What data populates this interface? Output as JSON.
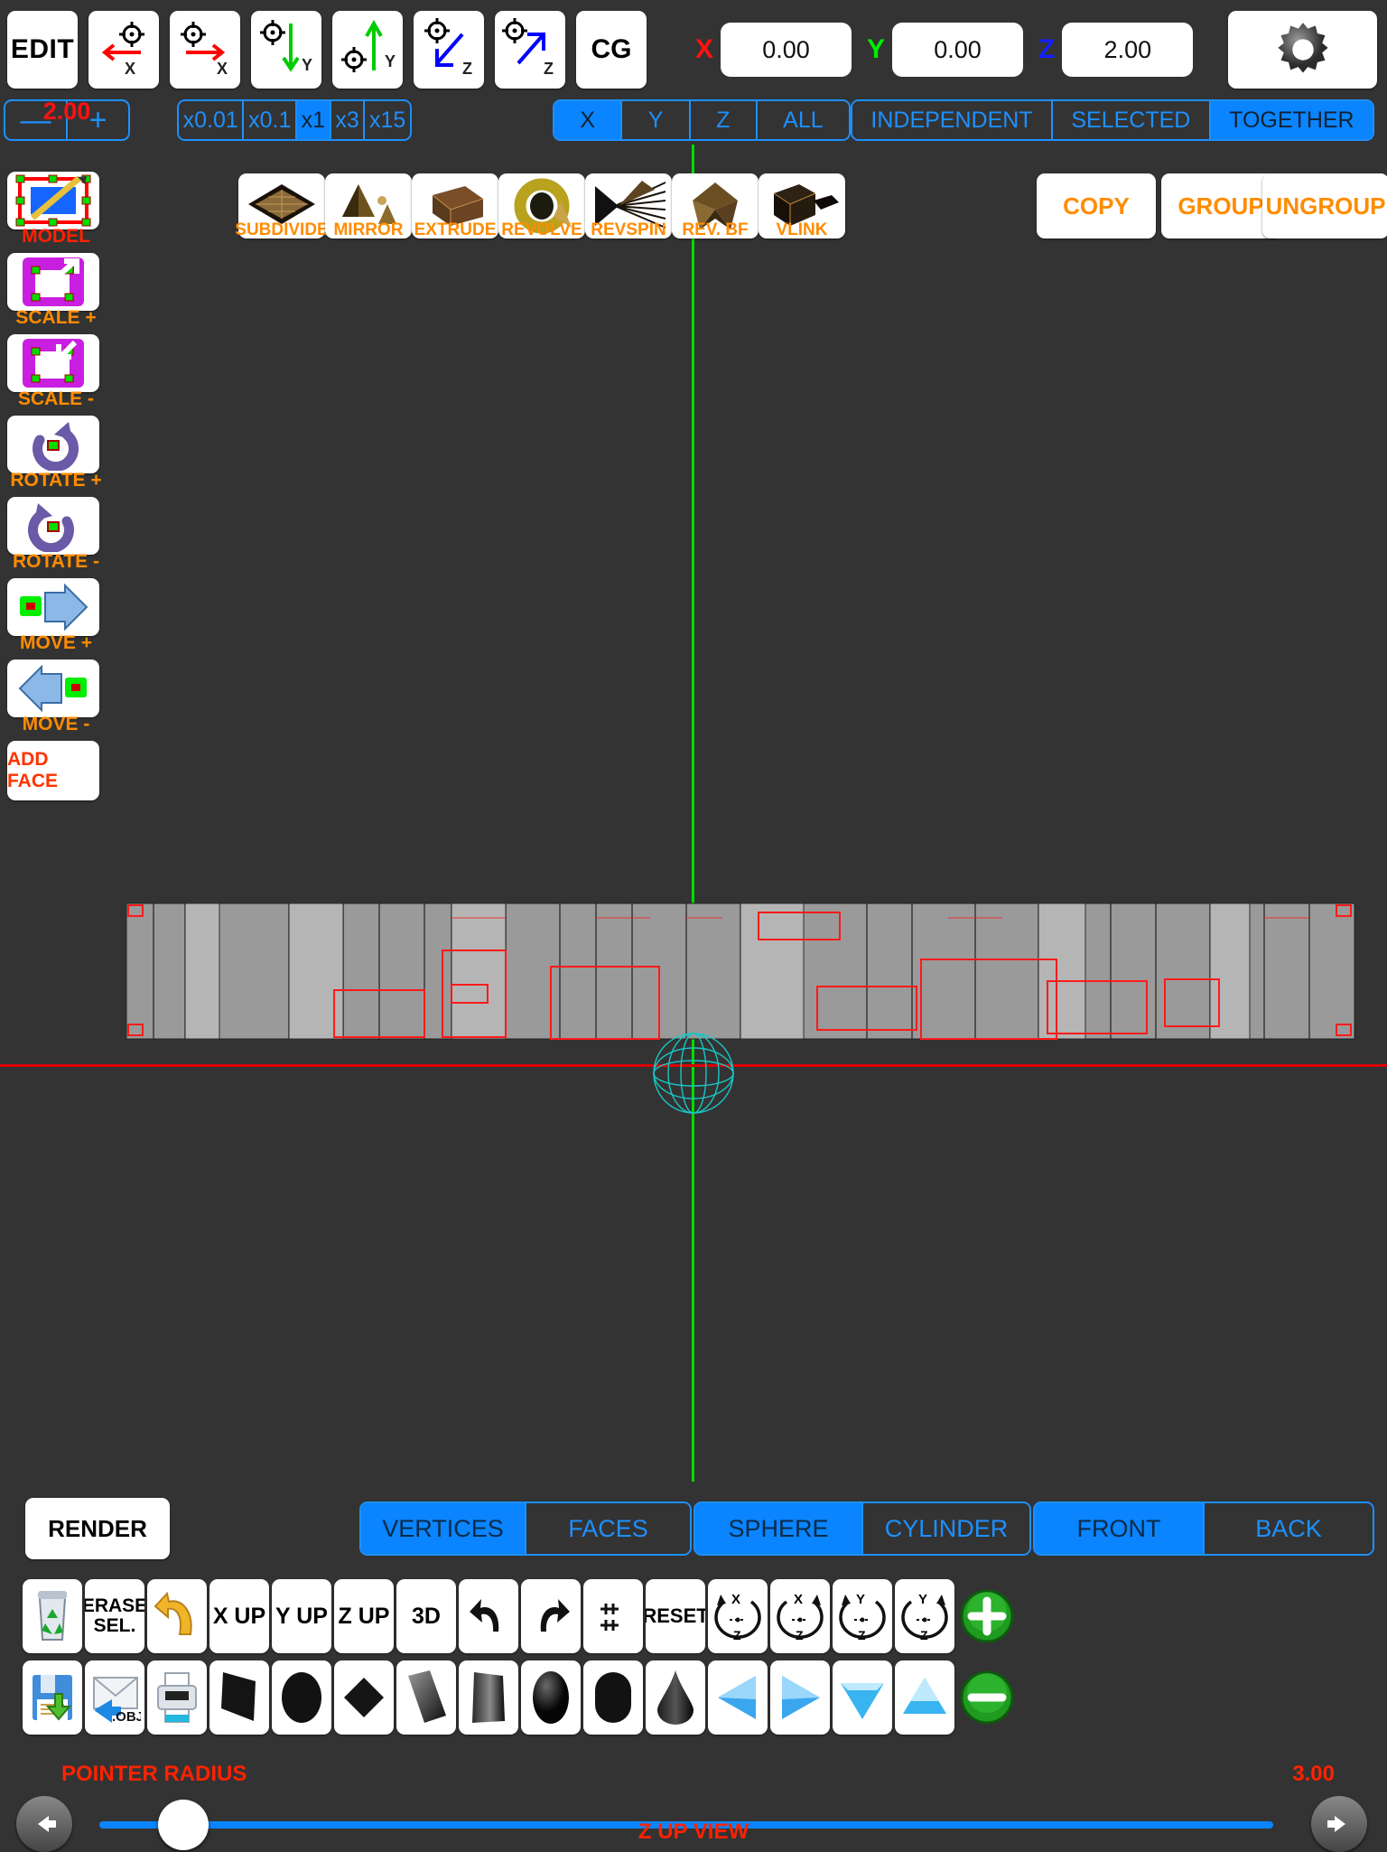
{
  "top_toolbar": {
    "edit_label": "EDIT",
    "cg_label": "CG",
    "axis_buttons": [
      {
        "name": "move-neg-x",
        "axis": "X",
        "color": "#ff0000",
        "dir": "left"
      },
      {
        "name": "move-pos-x",
        "axis": "X",
        "color": "#ff0000",
        "dir": "right"
      },
      {
        "name": "move-neg-y",
        "axis": "Y",
        "color": "#00cc00",
        "dir": "down"
      },
      {
        "name": "move-pos-y",
        "axis": "Y",
        "color": "#00cc00",
        "dir": "up"
      },
      {
        "name": "move-neg-z",
        "axis": "Z",
        "color": "#0000ff",
        "dir": "downleft"
      },
      {
        "name": "move-pos-z",
        "axis": "Z",
        "color": "#0000ff",
        "dir": "upright"
      }
    ],
    "coords": [
      {
        "axis": "X",
        "color": "#ff0000",
        "value": "0.00"
      },
      {
        "axis": "Y",
        "color": "#00ee00",
        "value": "0.00"
      },
      {
        "axis": "Z",
        "color": "#1122ff",
        "value": "2.00"
      }
    ],
    "settings_icon": "gear-icon"
  },
  "step_row": {
    "stepper_value": "2.00",
    "minus_label": "—",
    "plus_label": "+",
    "multipliers": {
      "options": [
        "x0.01",
        "x0.1",
        "x1",
        "x3",
        "x15"
      ],
      "selected": "x1"
    },
    "axes": {
      "options": [
        "X",
        "Y",
        "Z",
        "ALL"
      ],
      "selected": "X"
    },
    "mode": {
      "options": [
        "INDEPENDENT",
        "SELECTED",
        "TOGETHER"
      ],
      "selected": "TOGETHER"
    }
  },
  "sidebar": {
    "items": [
      {
        "label": "MODEL",
        "icon": "model-edit-icon",
        "label_color": "#ff2200"
      },
      {
        "label": "SCALE +",
        "icon": "scale-up-icon",
        "label_color": "#ff8c00"
      },
      {
        "label": "SCALE -",
        "icon": "scale-down-icon",
        "label_color": "#ff8c00"
      },
      {
        "label": "ROTATE +",
        "icon": "rotate-ccw-icon",
        "label_color": "#ff8c00"
      },
      {
        "label": "ROTATE -",
        "icon": "rotate-cw-icon",
        "label_color": "#ff8c00"
      },
      {
        "label": "MOVE +",
        "icon": "move-right-icon",
        "label_color": "#ff8c00"
      },
      {
        "label": "MOVE -",
        "icon": "move-left-icon",
        "label_color": "#ff8c00"
      }
    ],
    "add_face_label": "ADD FACE"
  },
  "operations": {
    "icon_items": [
      {
        "label": "SUBDIVIDE",
        "icon": "subdivide-icon"
      },
      {
        "label": "MIRROR",
        "icon": "mirror-icon"
      },
      {
        "label": "EXTRUDE",
        "icon": "extrude-icon"
      },
      {
        "label": "REVOLVE",
        "icon": "revolve-icon"
      },
      {
        "label": "REVSPIN",
        "icon": "revspin-icon"
      },
      {
        "label": "REV. BF",
        "icon": "revbf-icon"
      },
      {
        "label": "VLINK",
        "icon": "vlink-icon"
      }
    ],
    "text_items": [
      "COPY",
      "GROUP",
      "UNGROUP"
    ]
  },
  "bottom": {
    "render_label": "RENDER",
    "select_mode": {
      "options": [
        "VERTICES",
        "FACES"
      ],
      "selected": "VERTICES"
    },
    "primitive": {
      "options": [
        "SPHERE",
        "CYLINDER"
      ],
      "selected": "SPHERE"
    },
    "facing": {
      "options": [
        "FRONT",
        "BACK"
      ],
      "selected": "FRONT"
    },
    "row_a": [
      {
        "label": "",
        "icon": "trash-recycle-icon"
      },
      {
        "label": "ERASE SEL.",
        "icon": "erase-selection-icon"
      },
      {
        "label": "",
        "icon": "undo-arrow-gold-icon"
      },
      {
        "label": "X UP",
        "icon": "x-up-icon"
      },
      {
        "label": "Y UP",
        "icon": "y-up-icon"
      },
      {
        "label": "Z UP",
        "icon": "z-up-icon"
      },
      {
        "label": "3D",
        "icon": "three-d-icon"
      },
      {
        "label": "",
        "icon": "undo-icon"
      },
      {
        "label": "",
        "icon": "redo-icon"
      },
      {
        "label": "",
        "icon": "expand-icon"
      },
      {
        "label": "RESET",
        "icon": "reset-icon"
      },
      {
        "label": "",
        "icon": "rotate-xz-ccw-icon"
      },
      {
        "label": "",
        "icon": "rotate-xz-cw-icon"
      },
      {
        "label": "",
        "icon": "rotate-y-ccw-icon"
      },
      {
        "label": "",
        "icon": "rotate-y-cw-icon"
      },
      {
        "label": "",
        "icon": "plus-circle-icon"
      }
    ],
    "row_b": [
      {
        "label": "",
        "icon": "save-disk-icon"
      },
      {
        "label": ".OBJ",
        "icon": "import-obj-icon"
      },
      {
        "label": "",
        "icon": "print-icon"
      },
      {
        "label": "",
        "icon": "shape-plane-icon"
      },
      {
        "label": "",
        "icon": "shape-ellipse-icon"
      },
      {
        "label": "",
        "icon": "shape-diamond-icon"
      },
      {
        "label": "",
        "icon": "shape-slab-icon"
      },
      {
        "label": "",
        "icon": "shape-box-icon"
      },
      {
        "label": "",
        "icon": "shape-sphere-icon"
      },
      {
        "label": "",
        "icon": "shape-capsule-icon"
      },
      {
        "label": "",
        "icon": "shape-cone-icon"
      },
      {
        "label": "",
        "icon": "shape-wedge-left-icon"
      },
      {
        "label": "",
        "icon": "shape-wedge-right-icon"
      },
      {
        "label": "",
        "icon": "shape-pyramid-down-icon"
      },
      {
        "label": "",
        "icon": "shape-pyramid-up-icon"
      },
      {
        "label": "",
        "icon": "minus-circle-icon"
      }
    ],
    "pointer_radius_label": "POINTER RADIUS",
    "pointer_radius_value": "3.00",
    "status_label": "Z UP VIEW",
    "prev_icon": "arrow-left-icon",
    "next_icon": "arrow-right-icon"
  },
  "colors": {
    "accent": "#0a84ff",
    "outline": "#1e90ff",
    "orange": "#ff8c00",
    "red": "#ff2200",
    "bg": "#333333",
    "axis_x": "#dd0000",
    "axis_y": "#00dd00"
  }
}
